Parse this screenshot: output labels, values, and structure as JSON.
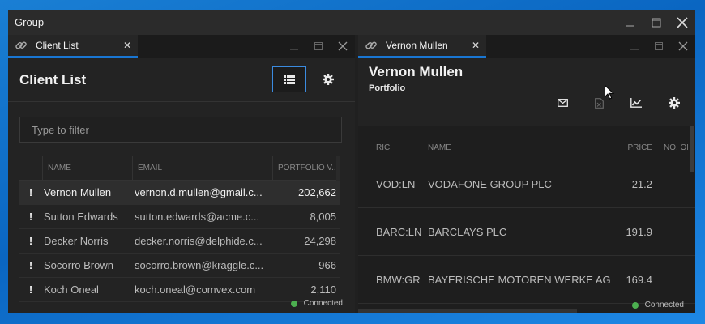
{
  "window": {
    "title": "Group"
  },
  "client_list": {
    "tab_label": "Client List",
    "title": "Client List",
    "filter_placeholder": "Type to filter",
    "columns": [
      "NAME",
      "EMAIL",
      "PORTFOLIO V..."
    ],
    "rows": [
      {
        "name": "Vernon Mullen",
        "email": "vernon.d.mullen@gmail.c...",
        "value": "202,662",
        "selected": true
      },
      {
        "name": "Sutton Edwards",
        "email": "sutton.edwards@acme.c...",
        "value": "8,005"
      },
      {
        "name": "Decker Norris",
        "email": "decker.norris@delphide.c...",
        "value": "24,298"
      },
      {
        "name": "Socorro Brown",
        "email": "socorro.brown@kraggle.c...",
        "value": "966"
      },
      {
        "name": "Koch Oneal",
        "email": "koch.oneal@comvex.com",
        "value": "2,110"
      }
    ],
    "flag_glyph": "!",
    "status": "Connected"
  },
  "portfolio": {
    "tab_label": "Vernon Mullen",
    "name": "Vernon Mullen",
    "subtitle": "Portfolio",
    "columns": [
      "RIC",
      "NAME",
      "PRICE",
      "NO. OF"
    ],
    "rows": [
      {
        "ric": "VOD:LN",
        "name": "VODAFONE GROUP PLC",
        "price": "21.2"
      },
      {
        "ric": "BARC:LN",
        "name": "BARCLAYS PLC",
        "price": "191.9"
      },
      {
        "ric": "BMW:GR",
        "name": "BAYERISCHE MOTOREN WERKE AG",
        "price": "169.4"
      }
    ],
    "status": "Connected"
  },
  "icons": {
    "link": "link-icon",
    "close": "close-icon",
    "minimize": "minimize-icon",
    "maximize": "maximize-icon",
    "grid": "grid-icon",
    "gear": "gear-icon",
    "mail": "mail-icon",
    "excel": "excel-icon",
    "chart": "chart-icon",
    "cursor": "mouse-cursor-icon"
  },
  "colors": {
    "accent": "#1976d2",
    "connected": "#4caf50",
    "background": "#0a66c2"
  }
}
